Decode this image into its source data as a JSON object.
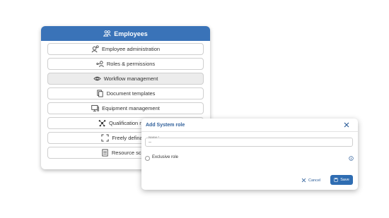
{
  "panel": {
    "title": "Employees",
    "title_icon": "people-icon",
    "header_color": "#3a73b8",
    "items": [
      {
        "label": "Employee administration",
        "icon": "user-gear-icon"
      },
      {
        "label": "Roles & permissions",
        "icon": "user-key-icon"
      },
      {
        "label": "Workflow management",
        "icon": "eye-gear-icon"
      },
      {
        "label": "Document templates",
        "icon": "documents-icon"
      },
      {
        "label": "Equipment management",
        "icon": "monitor-icon"
      },
      {
        "label": "Qualification mana",
        "icon": "network-icon"
      },
      {
        "label": "Freely definable",
        "icon": "expand-icon"
      },
      {
        "label": "Resource sched",
        "icon": "document-list-icon"
      }
    ]
  },
  "dialog": {
    "title": "Add System role",
    "name_label": "Name *",
    "name_value": "--",
    "exclusive_label": "Exclusive role",
    "cancel_label": "Cancel",
    "save_label": "Save",
    "accent_color": "#2f6db2"
  }
}
